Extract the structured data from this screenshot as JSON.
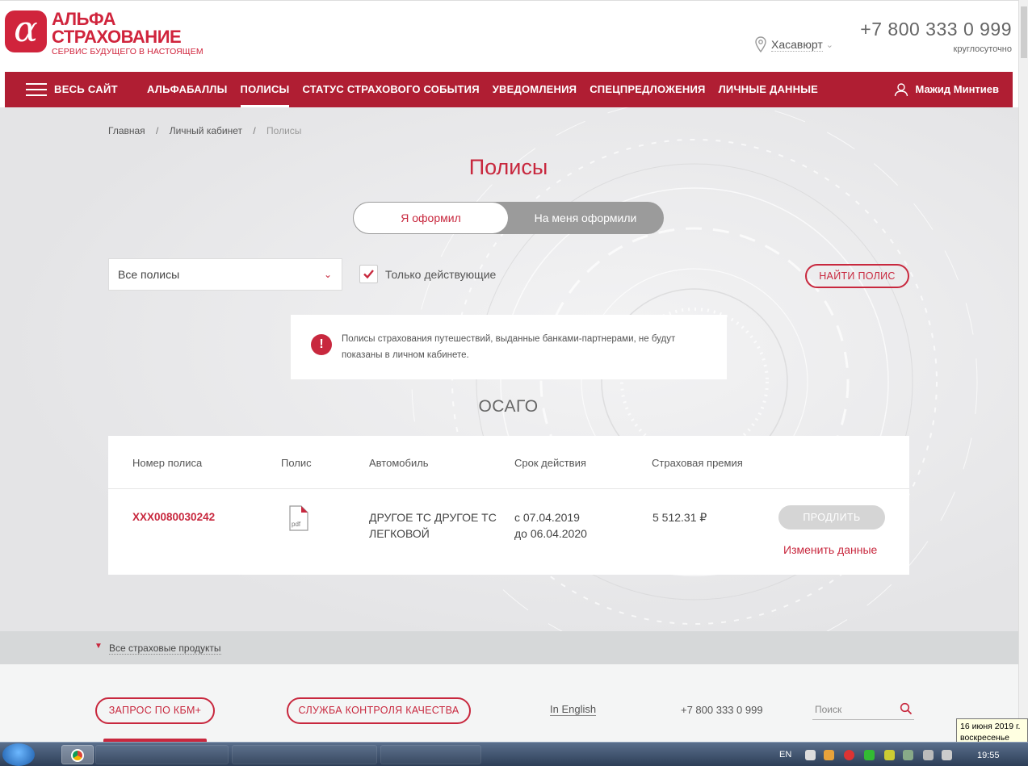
{
  "header": {
    "logo_mark": "α",
    "logo_name_line1": "АЛЬФА",
    "logo_name_line2": "СТРАХОВАНИЕ",
    "logo_tagline": "СЕРВИС БУДУЩЕГО В НАСТОЯЩЕМ",
    "city": "Хасавюрт",
    "phone": "+7 800 333 0 999",
    "phone_note": "круглосуточно"
  },
  "nav": {
    "all_site": "ВЕСЬ САЙТ",
    "items": [
      {
        "label": "АЛЬФАБАЛЛЫ"
      },
      {
        "label": "ПОЛИСЫ"
      },
      {
        "label": "СТАТУС СТРАХОВОГО СОБЫТИЯ"
      },
      {
        "label": "УВЕДОМЛЕНИЯ"
      },
      {
        "label": "СПЕЦПРЕДЛОЖЕНИЯ"
      },
      {
        "label": "ЛИЧНЫЕ ДАННЫЕ"
      }
    ],
    "active_index": 1,
    "user_name": "Мажид Минтиев"
  },
  "breadcrumb": {
    "items": [
      "Главная",
      "Личный кабинет",
      "Полисы"
    ]
  },
  "page": {
    "title": "Полисы",
    "toggle": {
      "selected": "Я оформил",
      "other": "На меня оформили"
    },
    "filter": {
      "select_value": "Все полисы",
      "only_active_label": "Только действующие",
      "only_active_checked": true,
      "find_button": "НАЙТИ ПОЛИС"
    },
    "alert": {
      "icon": "!",
      "text": "Полисы страхования путешествий, выданные банками-партнерами, не будут показаны в личном кабинете."
    },
    "section_title": "ОСАГО",
    "table": {
      "columns": [
        "Номер полиса",
        "Полис",
        "Автомобиль",
        "Срок действия",
        "Страховая премия"
      ],
      "rows": [
        {
          "number": "XXX0080030242",
          "pdf_label": "pdf",
          "car_line1": "ДРУГОЕ ТС ДРУГОЕ ТС",
          "car_line2": "ЛЕГКОВОЙ",
          "period_from": "с 07.04.2019",
          "period_to": "до 06.04.2020",
          "premium": "5 512.31 ₽",
          "renew_label": "ПРОДЛИТЬ",
          "edit_label": "Изменить данные"
        }
      ]
    }
  },
  "products": {
    "label": "Все страховые продукты"
  },
  "footer": {
    "kbm_button": "ЗАПРОС ПО КБМ+",
    "quality_button": "СЛУЖБА КОНТРОЛЯ КАЧЕСТВА",
    "english_link": "In English",
    "phone": "+7 800 333 0 999",
    "search_placeholder": "Поиск"
  },
  "system": {
    "date_line1": "16 июня 2019 г.",
    "date_line2": "воскресенье",
    "language": "EN",
    "clock": "19:55"
  },
  "colors": {
    "brand": "#c8283e",
    "nav_bg": "#b01e33",
    "page_bg": "#e9e9ea"
  }
}
